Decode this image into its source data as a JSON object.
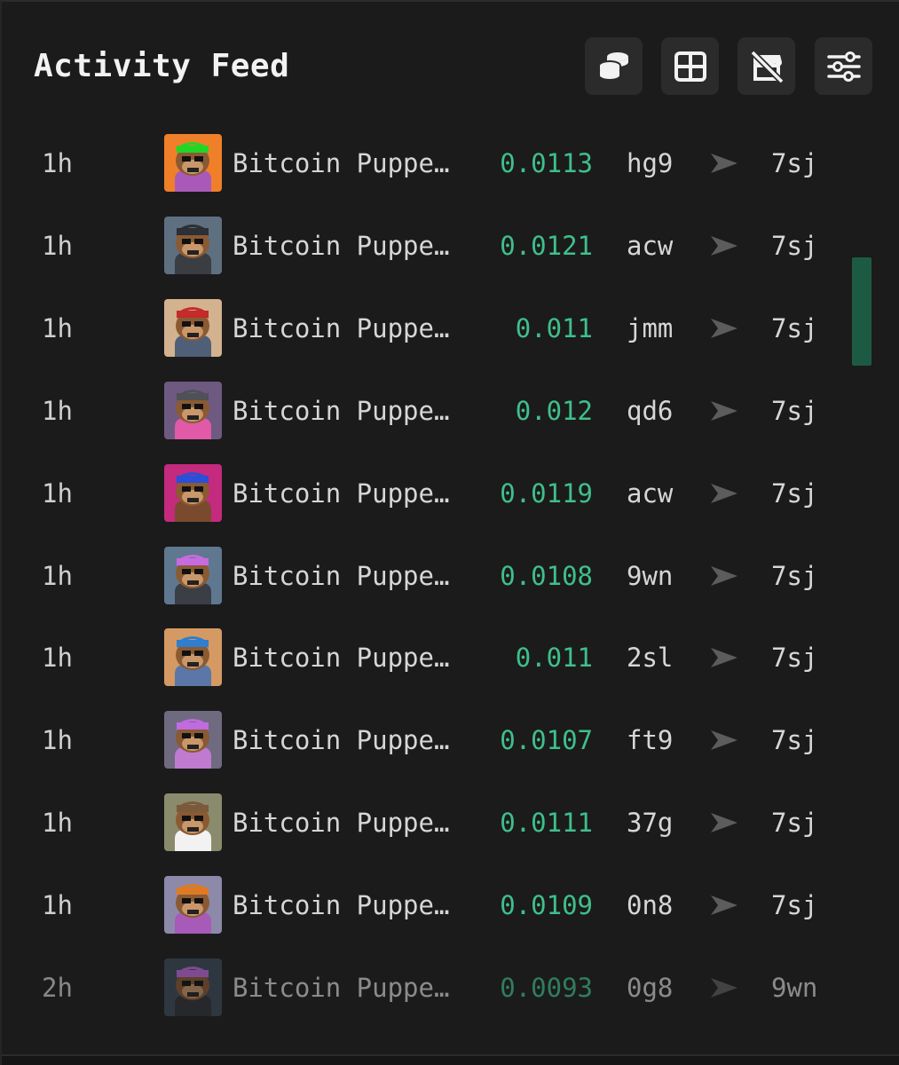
{
  "header": {
    "title": "Activity Feed",
    "buttons": [
      {
        "name": "coins-stack-icon"
      },
      {
        "name": "grid-icon"
      },
      {
        "name": "store-off-icon"
      },
      {
        "name": "sliders-icon"
      }
    ]
  },
  "colors": {
    "background": "#1b1b1b",
    "button_bg": "#2b2b2b",
    "price_green": "#3fbf8c",
    "scroll_thumb": "#1d5a43",
    "text": "#d6d6d6"
  },
  "feed": {
    "rows": [
      {
        "time": "1h",
        "name": "Bitcoin Puppe…",
        "price": "0.0113",
        "from": "hg9",
        "to": "7sj",
        "thumb_bg": "#f07f2a",
        "hat": "#22d626",
        "body": "#a95ab8"
      },
      {
        "time": "1h",
        "name": "Bitcoin Puppe…",
        "price": "0.0121",
        "from": "acw",
        "to": "7sj",
        "thumb_bg": "#5e6f80",
        "hat": "#2c2f33",
        "body": "#3a3d42"
      },
      {
        "time": "1h",
        "name": "Bitcoin Puppe…",
        "price": "0.011",
        "from": "jmm",
        "to": "7sj",
        "thumb_bg": "#d3b28f",
        "hat": "#c42b2b",
        "body": "#4f5f78"
      },
      {
        "time": "1h",
        "name": "Bitcoin Puppe…",
        "price": "0.012",
        "from": "qd6",
        "to": "7sj",
        "thumb_bg": "#6e5a80",
        "hat": "#4f5157",
        "body": "#e05aa8"
      },
      {
        "time": "1h",
        "name": "Bitcoin Puppe…",
        "price": "0.0119",
        "from": "acw",
        "to": "7sj",
        "thumb_bg": "#c42a7e",
        "hat": "#2a4fd8",
        "body": "#7a4a2e"
      },
      {
        "time": "1h",
        "name": "Bitcoin Puppe…",
        "price": "0.0108",
        "from": "9wn",
        "to": "7sj",
        "thumb_bg": "#5f7890",
        "hat": "#c66be0",
        "body": "#3b3e44"
      },
      {
        "time": "1h",
        "name": "Bitcoin Puppe…",
        "price": "0.011",
        "from": "2sl",
        "to": "7sj",
        "thumb_bg": "#d59a63",
        "hat": "#2f7ed0",
        "body": "#5a77a8"
      },
      {
        "time": "1h",
        "name": "Bitcoin Puppe…",
        "price": "0.0107",
        "from": "ft9",
        "to": "7sj",
        "thumb_bg": "#6f6a80",
        "hat": "#c06be0",
        "body": "#c07ad0"
      },
      {
        "time": "1h",
        "name": "Bitcoin Puppe…",
        "price": "0.0111",
        "from": "37g",
        "to": "7sj",
        "thumb_bg": "#8a8b6c",
        "hat": "#7a5a3a",
        "body": "#f2f2f2"
      },
      {
        "time": "1h",
        "name": "Bitcoin Puppe…",
        "price": "0.0109",
        "from": "0n8",
        "to": "7sj",
        "thumb_bg": "#8c8aa8",
        "hat": "#e07a22",
        "body": "#a85ab8"
      },
      {
        "time": "2h",
        "name": "Bitcoin Puppe…",
        "price": "0.0093",
        "from": "0g8",
        "to": "9wn",
        "thumb_bg": "#3c4a5a",
        "hat": "#c06be0",
        "body": "#2f3236"
      }
    ]
  }
}
